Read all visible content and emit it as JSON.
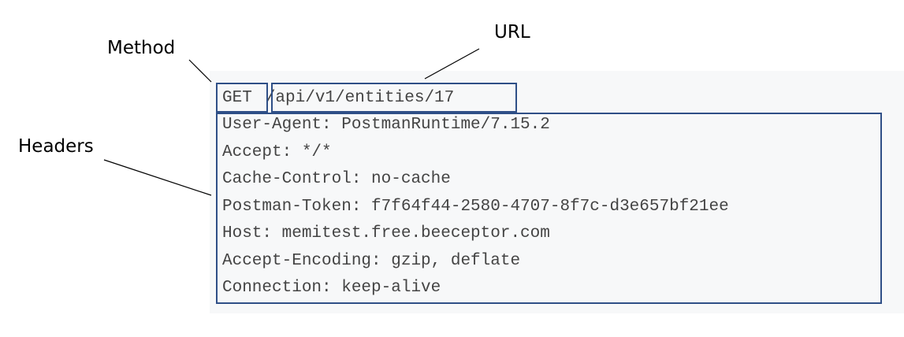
{
  "callouts": {
    "method": "Method",
    "url": "URL",
    "headers": "Headers"
  },
  "request": {
    "method": "GET",
    "path": "/api/v1/entities/17",
    "headers": [
      "User-Agent: PostmanRuntime/7.15.2",
      "Accept: */*",
      "Cache-Control: no-cache",
      "Postman-Token: f7f64f44-2580-4707-8f7c-d3e657bf21ee",
      "Host: memitest.free.beeceptor.com",
      "Accept-Encoding: gzip, deflate",
      "Connection: keep-alive"
    ]
  },
  "colors": {
    "box_border": "#2f4f87",
    "code_background": "#f7f8f9",
    "code_text": "#444444"
  }
}
